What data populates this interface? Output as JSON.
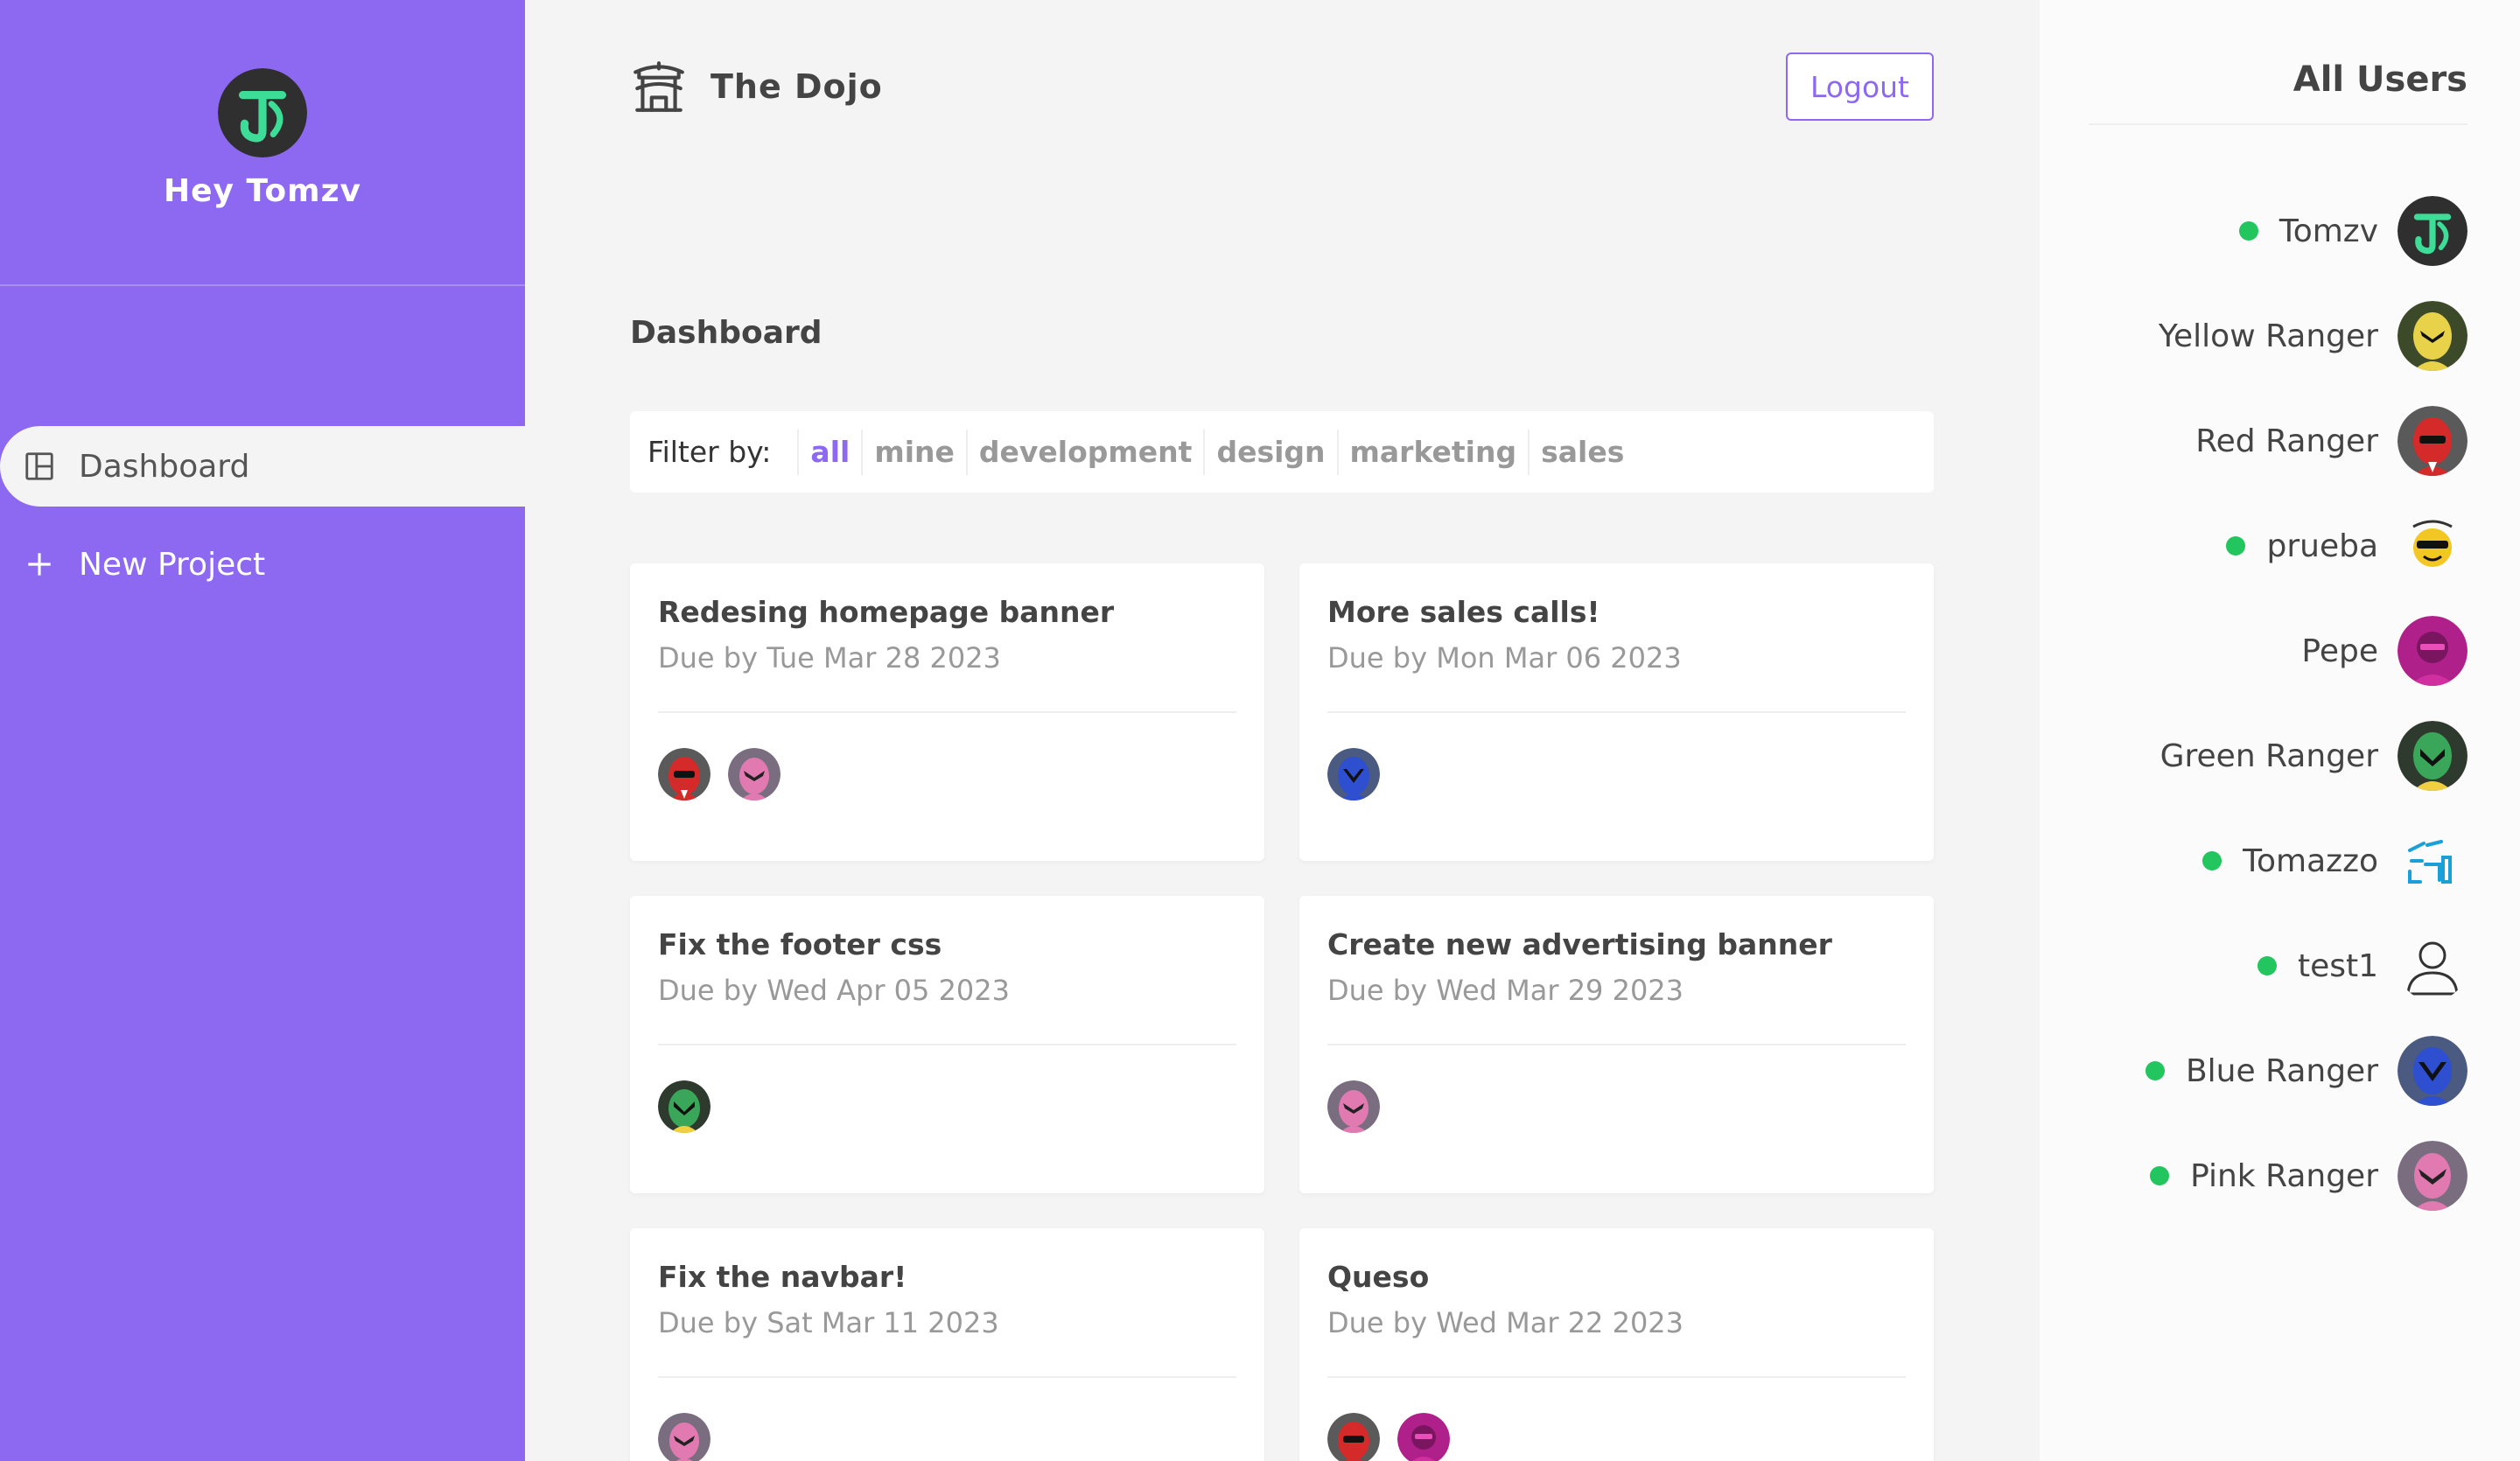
{
  "sidebar": {
    "greeting": "Hey Tomzv",
    "nav": [
      {
        "label": "Dashboard",
        "icon": "dashboard-icon",
        "active": true
      },
      {
        "label": "New Project",
        "icon": "plus-icon",
        "active": false
      }
    ]
  },
  "header": {
    "brand": "The Dojo",
    "logout_label": "Logout"
  },
  "main": {
    "title": "Dashboard",
    "filter_label": "Filter by:",
    "filters": [
      "all",
      "mine",
      "development",
      "design",
      "marketing",
      "sales"
    ],
    "active_filter": "all"
  },
  "projects": [
    {
      "title": "Redesing homepage banner",
      "due": "Due by Tue Mar 28 2023",
      "assignees": [
        "red-ranger-avatar",
        "pink-ranger-avatar"
      ]
    },
    {
      "title": "More sales calls!",
      "due": "Due by Mon Mar 06 2023",
      "assignees": [
        "blue-ranger-avatar"
      ]
    },
    {
      "title": "Fix the footer css",
      "due": "Due by Wed Apr 05 2023",
      "assignees": [
        "green-ranger-avatar"
      ]
    },
    {
      "title": "Create new advertising banner",
      "due": "Due by Wed Mar 29 2023",
      "assignees": [
        "pink-ranger-avatar"
      ]
    },
    {
      "title": "Fix the navbar!",
      "due": "Due by Sat Mar 11 2023",
      "assignees": [
        "pink-ranger-avatar"
      ]
    },
    {
      "title": "Queso",
      "due": "Due by Wed Mar 22 2023",
      "assignees": [
        "red-ranger-avatar",
        "pepe-avatar"
      ]
    }
  ],
  "users_panel": {
    "title": "All Users",
    "users": [
      {
        "name": "Tomzv",
        "online": true,
        "avatar": "tomzv-avatar"
      },
      {
        "name": "Yellow Ranger",
        "online": false,
        "avatar": "yellow-ranger-avatar"
      },
      {
        "name": "Red Ranger",
        "online": false,
        "avatar": "red-ranger-avatar"
      },
      {
        "name": "prueba",
        "online": true,
        "avatar": "prueba-avatar"
      },
      {
        "name": "Pepe",
        "online": false,
        "avatar": "pepe-avatar"
      },
      {
        "name": "Green Ranger",
        "online": false,
        "avatar": "green-ranger-avatar"
      },
      {
        "name": "Tomazzo",
        "online": true,
        "avatar": "tomazzo-avatar"
      },
      {
        "name": "test1",
        "online": true,
        "avatar": "default-user-icon"
      },
      {
        "name": "Blue Ranger",
        "online": true,
        "avatar": "blue-ranger-avatar"
      },
      {
        "name": "Pink Ranger",
        "online": true,
        "avatar": "pink-ranger-avatar"
      }
    ]
  },
  "colors": {
    "primary": "#8d69f1",
    "online": "#22c55e",
    "background": "#f4f4f4"
  }
}
